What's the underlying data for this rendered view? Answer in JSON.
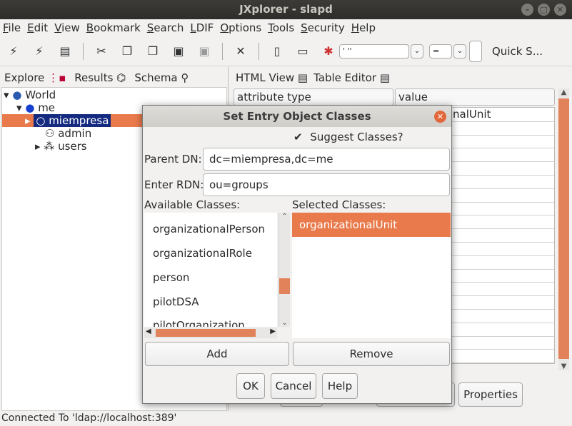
{
  "window": {
    "title": "JXplorer - slapd"
  },
  "menu": [
    "File",
    "Edit",
    "View",
    "Bookmark",
    "Search",
    "LDIF",
    "Options",
    "Tools",
    "Security",
    "Help"
  ],
  "toolbar": {
    "icons": [
      "connect-icon",
      "disconnect-icon",
      "print-icon",
      "cut-icon",
      "copy-icon",
      "copy-dn-icon",
      "paste-icon",
      "paste-alias-icon",
      "delete-icon",
      "new-icon",
      "rename-icon"
    ],
    "search_field": "' ''",
    "operator": "=",
    "quick_search_label": "Quick S..."
  },
  "left_tabs": {
    "explore": "Explore",
    "results": "Results",
    "schema": "Schema"
  },
  "tree": {
    "root": "World",
    "me": "me",
    "miempresa": "miempresa",
    "admin": "admin",
    "users": "users"
  },
  "right_tabs": {
    "html_view": "HTML View",
    "table_editor": "Table Editor"
  },
  "table": {
    "col_attr": "attribute type",
    "col_value": "value",
    "first_value_fragment": "nalUnit"
  },
  "bottom_buttons": {
    "properties": "Properties"
  },
  "status": "Connected To 'ldap://localhost:389'",
  "dialog": {
    "title": "Set Entry Object Classes",
    "suggest_label": "Suggest Classes?",
    "suggest_checked": true,
    "parent_dn_label": "Parent DN:",
    "parent_dn_value": "dc=miempresa,dc=me",
    "rdn_label": "Enter RDN:",
    "rdn_value": "ou=groups",
    "available_label": "Available Classes:",
    "available": [
      "organizationalPerson",
      "organizationalRole",
      "person",
      "pilotDSA",
      "pilotOrganization"
    ],
    "selected_label": "Selected Classes:",
    "selected": [
      "organizationalUnit"
    ],
    "add_button": "Add",
    "remove_button": "Remove",
    "ok_button": "OK",
    "cancel_button": "Cancel",
    "help_button": "Help"
  },
  "colors": {
    "accent": "#e97a4b",
    "tree_selection": "#132a80"
  }
}
